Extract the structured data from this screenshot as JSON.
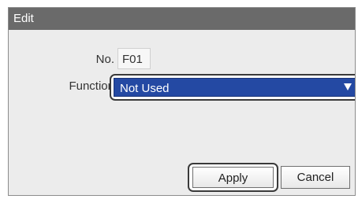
{
  "dialog": {
    "title": "Edit",
    "no_label": "No.",
    "no_value": "F01",
    "function_label": "Function",
    "function_value": "Not Used",
    "apply_label": "Apply",
    "cancel_label": "Cancel"
  },
  "icons": {
    "dropdown": "dropdown-arrow-icon"
  },
  "colors": {
    "titlebar": "#6a6a6a",
    "selected_dropdown": "#2449a3",
    "dialog_background": "#ececec"
  }
}
